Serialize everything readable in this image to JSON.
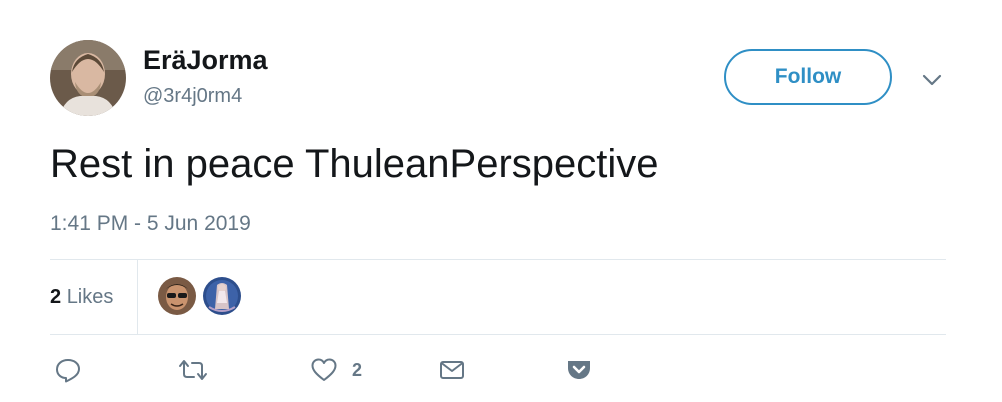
{
  "tweet": {
    "author": {
      "display_name": "EräJorma",
      "handle": "@3r4j0rm4"
    },
    "follow_label": "Follow",
    "text": "Rest in peace ThuleanPerspective",
    "timestamp": "1:41 PM - 5 Jun 2019",
    "stats": {
      "likes_count": "2",
      "likes_label": "Likes"
    },
    "actions": {
      "like_count": "2"
    }
  },
  "colors": {
    "accent": "#2f8fc5",
    "text": "#14171a",
    "secondary_text": "#657786",
    "divider": "#e1e8ed"
  },
  "icons": [
    "reply-icon",
    "retweet-icon",
    "heart-icon",
    "envelope-icon",
    "pocket-icon",
    "chevron-down-icon"
  ]
}
